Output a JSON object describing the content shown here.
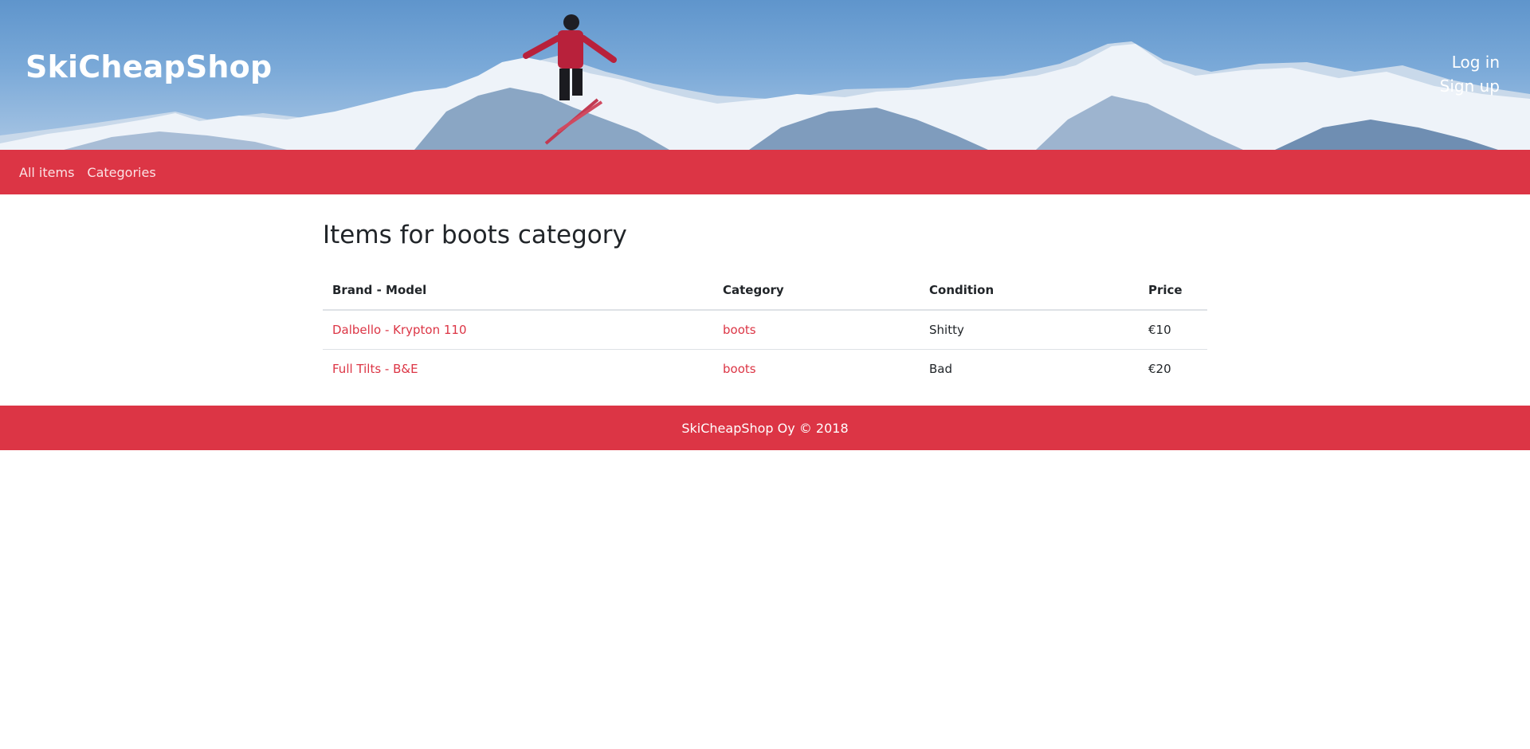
{
  "header": {
    "brand": "SkiCheapShop",
    "login_label": "Log in",
    "signup_label": "Sign up"
  },
  "nav": {
    "items": [
      {
        "label": "All items"
      },
      {
        "label": "Categories"
      }
    ]
  },
  "main": {
    "title": "Items for boots category",
    "table": {
      "headers": [
        "Brand - Model",
        "Category",
        "Condition",
        "Price"
      ],
      "rows": [
        {
          "brand_model": "Dalbello - Krypton 110",
          "category": "boots",
          "condition": "Shitty",
          "price": "€10"
        },
        {
          "brand_model": "Full Tilts - B&E",
          "category": "boots",
          "condition": "Bad",
          "price": "€20"
        }
      ]
    }
  },
  "footer": {
    "text": "SkiCheapShop Oy © 2018"
  },
  "colors": {
    "accent": "#dc3545",
    "sky": "#6f9fd2",
    "text": "#212529"
  },
  "icons": {
    "banner_image": "mountain-skier-image"
  }
}
